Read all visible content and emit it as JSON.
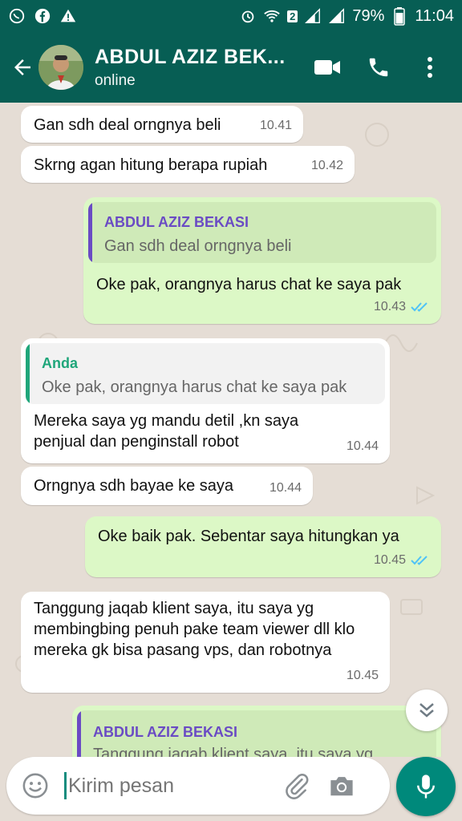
{
  "statusbar": {
    "battery_percent": "79%",
    "time": "11:04",
    "sim_badge": "2"
  },
  "header": {
    "contact_name": "ABDUL AZIZ BEK...",
    "status": "online"
  },
  "messages": [
    {
      "direction": "in",
      "text": "Gan sdh deal orngnya beli",
      "time": "10.41"
    },
    {
      "direction": "in",
      "text": "Skrng agan hitung berapa rupiah",
      "time": "10.42"
    },
    {
      "direction": "out",
      "quote": {
        "name": "ABDUL AZIZ BEKASI",
        "text": "Gan sdh deal orngnya beli"
      },
      "text": "Oke pak, orangnya harus chat ke saya pak",
      "time": "10.43"
    },
    {
      "direction": "in",
      "quote": {
        "name": "Anda",
        "text": "Oke pak, orangnya harus chat ke saya pak"
      },
      "text": "Mereka saya yg mandu detil ,kn saya penjual dan penginstall robot",
      "time": "10.44"
    },
    {
      "direction": "in",
      "text": "Orngnya sdh bayae ke saya",
      "time": "10.44"
    },
    {
      "direction": "out",
      "text": "Oke baik pak. Sebentar saya hitungkan ya",
      "time": "10.45"
    },
    {
      "direction": "in",
      "text": "Tanggung jaqab klient saya, itu saya yg membingbing penuh pake team viewer dll klo mereka gk bisa pasang vps, dan robotnya",
      "time": "10.45"
    },
    {
      "direction": "out",
      "quote": {
        "name": "ABDUL AZIZ BEKASI",
        "text": "Tanggung jaqab klient saya, itu saya yg"
      }
    }
  ],
  "composer": {
    "placeholder": "Kirim pesan"
  },
  "colors": {
    "header": "#075e54",
    "chat_background": "#e5ddd5",
    "outgoing_bubble": "#dcf8c6",
    "incoming_bubble": "#ffffff",
    "quote_name_purple": "#6a4bc4",
    "quote_name_you": "#1fa67a",
    "read_ticks": "#4fc3f7",
    "mic_button": "#00897b"
  },
  "icons": [
    "whatsapp-icon",
    "facebook-icon",
    "warning-icon",
    "alarm-icon",
    "wifi-icon",
    "signal-icon",
    "battery-icon",
    "back-arrow-icon",
    "video-call-icon",
    "phone-icon",
    "more-vert-icon",
    "double-check-icon",
    "chevron-double-down-icon",
    "emoji-icon",
    "attach-icon",
    "camera-icon",
    "mic-icon"
  ]
}
